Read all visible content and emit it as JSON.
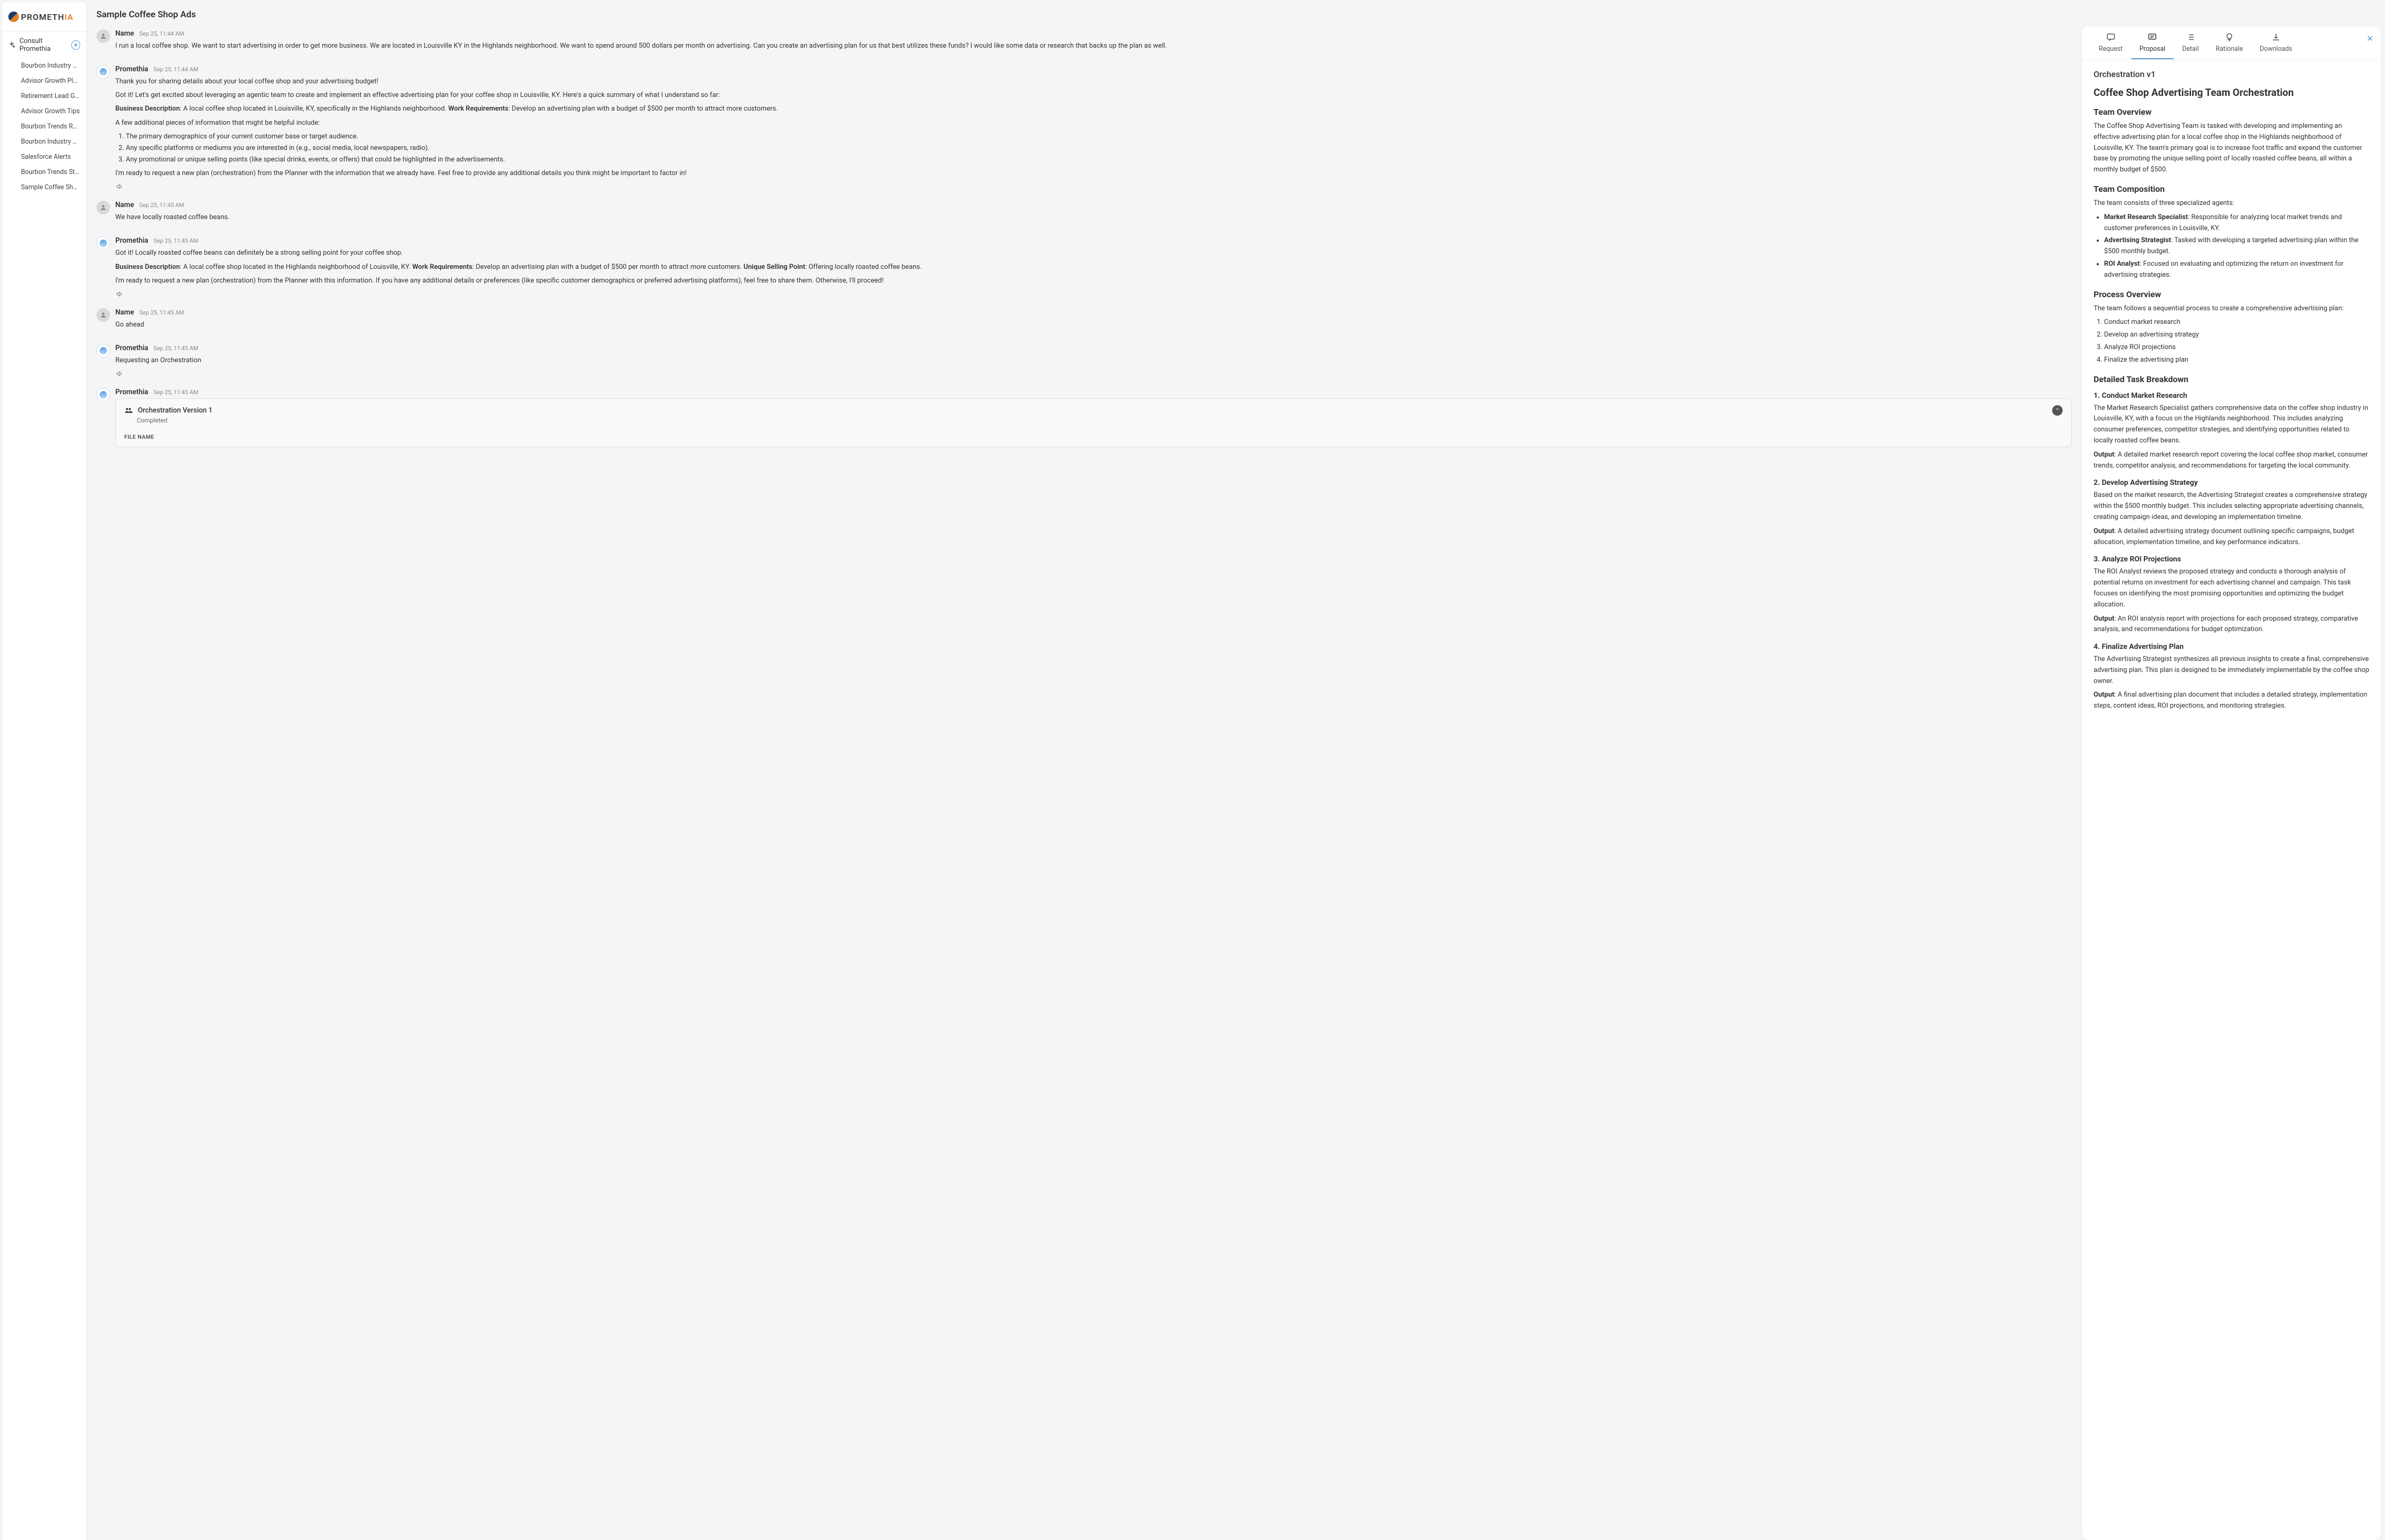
{
  "brand": {
    "name_a": "PROMETH",
    "name_b": "IA"
  },
  "sidebar": {
    "consult_label": "Consult Promethia",
    "items": [
      "Bourbon Industry St...",
      "Advisor Growth Plan",
      "Retirement Lead Gen",
      "Advisor Growth Tips",
      "Bourbon Trends Re...",
      "Bourbon Industry Tr...",
      "Salesforce Alerts",
      "Bourbon Trends Study",
      "Sample Coffee Sho..."
    ]
  },
  "page_title": "Sample Coffee Shop Ads",
  "messages": [
    {
      "author": "Name",
      "role": "user",
      "time": "Sep 25, 11:44 AM",
      "text1": "I run a local coffee shop. We want to start advertising in order to get more business. We are located in Louisville KY in the Highlands neighborhood. We want to spend around 500 dollars per month on advertising. Can you create an advertising plan for us that best utilizes these funds? I would like some data or research that backs up the plan as well."
    },
    {
      "author": "Promethia",
      "role": "bot",
      "time": "Sep 25, 11:44 AM",
      "text1": "Thank you for sharing details about your local coffee shop and your advertising budget!",
      "text2": "Got it! Let's get excited about leveraging an agentic team to create and implement an effective advertising plan for your coffee shop in Louisville, KY. Here's a quick summary of what I understand so far:",
      "biz_label": "Business Description",
      "biz_text": ": A local coffee shop located in Louisville, KY, specifically in the Highlands neighborhood. ",
      "work_label": "Work Requirements",
      "work_text": ": Develop an advertising plan with a budget of $500 per month to attract more customers.",
      "text3": "A few additional pieces of information that might be helpful include:",
      "li1": "The primary demographics of your current customer base or target audience.",
      "li2": "Any specific platforms or mediums you are interested in (e.g., social media, local newspapers, radio).",
      "li3": "Any promotional or unique selling points (like special drinks, events, or offers) that could be highlighted in the advertisements.",
      "text4": "I'm ready to request a new plan (orchestration) from the Planner with the information that we already have. Feel free to provide any additional details you think might be important to factor in!"
    },
    {
      "author": "Name",
      "role": "user",
      "time": "Sep 25, 11:45 AM",
      "text1": "We have locally roasted coffee beans."
    },
    {
      "author": "Promethia",
      "role": "bot",
      "time": "Sep 25, 11:45 AM",
      "text1": "Got it! Locally roasted coffee beans can definitely be a strong selling point for your coffee shop.",
      "biz_label": "Business Description",
      "biz_text": ": A local coffee shop located in the Highlands neighborhood of Louisville, KY. ",
      "work_label": "Work Requirements",
      "work_text": ": Develop an advertising plan with a budget of $500 per month to attract more customers. ",
      "usp_label": "Unique Selling Point",
      "usp_text": ": Offering locally roasted coffee beans.",
      "text2": "I'm ready to request a new plan (orchestration) from the Planner with this information. If you have any additional details or preferences (like specific customer demographics or preferred advertising platforms), feel free to share them. Otherwise, I'll proceed!"
    },
    {
      "author": "Name",
      "role": "user",
      "time": "Sep 25, 11:45 AM",
      "text1": "Go ahead"
    },
    {
      "author": "Promethia",
      "role": "bot",
      "time": "Sep 25, 11:45 AM",
      "text1": "Requesting an Orchestration"
    },
    {
      "author": "Promethia",
      "role": "bot",
      "time": "Sep 25, 11:45 AM",
      "orch_title": "Orchestration Version 1",
      "orch_status": "Completed",
      "file_label": "FILE NAME"
    }
  ],
  "detail": {
    "tabs": {
      "request": "Request",
      "proposal": "Proposal",
      "detail": "Detail",
      "rationale": "Rationale",
      "downloads": "Downloads"
    },
    "version": "Orchestration v1",
    "h1": "Coffee Shop Advertising Team Orchestration",
    "overview_h": "Team Overview",
    "overview_p": "The Coffee Shop Advertising Team is tasked with developing and implementing an effective advertising plan for a local coffee shop in the Highlands neighborhood of Louisville, KY. The team's primary goal is to increase foot traffic and expand the customer base by promoting the unique selling point of locally roasted coffee beans, all within a monthly budget of $500.",
    "comp_h": "Team Composition",
    "comp_p": "The team consists of three specialized agents:",
    "comp_li1_b": "Market Research Specialist",
    "comp_li1_t": ": Responsible for analyzing local market trends and customer preferences in Louisville, KY.",
    "comp_li2_b": "Advertising Strategist",
    "comp_li2_t": ": Tasked with developing a targeted advertising plan within the $500 monthly budget.",
    "comp_li3_b": "ROI Analyst",
    "comp_li3_t": ": Focused on evaluating and optimizing the return on investment for advertising strategies.",
    "proc_h": "Process Overview",
    "proc_p": "The team follows a sequential process to create a comprehensive advertising plan:",
    "proc_li1": "Conduct market research",
    "proc_li2": "Develop an advertising strategy",
    "proc_li3": "Analyze ROI projections",
    "proc_li4": "Finalize the advertising plan",
    "task_h": "Detailed Task Breakdown",
    "t1_h": "1. Conduct Market Research",
    "t1_p": "The Market Research Specialist gathers comprehensive data on the coffee shop industry in Louisville, KY, with a focus on the Highlands neighborhood. This includes analyzing consumer preferences, competitor strategies, and identifying opportunities related to locally roasted coffee beans.",
    "t1_ob": "Output",
    "t1_ot": ": A detailed market research report covering the local coffee shop market, consumer trends, competitor analysis, and recommendations for targeting the local community.",
    "t2_h": "2. Develop Advertising Strategy",
    "t2_p": "Based on the market research, the Advertising Strategist creates a comprehensive strategy within the $500 monthly budget. This includes selecting appropriate advertising channels, creating campaign ideas, and developing an implementation timeline.",
    "t2_ob": "Output",
    "t2_ot": ": A detailed advertising strategy document outlining specific campaigns, budget allocation, implementation timeline, and key performance indicators.",
    "t3_h": "3. Analyze ROI Projections",
    "t3_p": "The ROI Analyst reviews the proposed strategy and conducts a thorough analysis of potential returns on investment for each advertising channel and campaign. This task focuses on identifying the most promising opportunities and optimizing the budget allocation.",
    "t3_ob": "Output",
    "t3_ot": ": An ROI analysis report with projections for each proposed strategy, comparative analysis, and recommendations for budget optimization.",
    "t4_h": "4. Finalize Advertising Plan",
    "t4_p": "The Advertising Strategist synthesizes all previous insights to create a final, comprehensive advertising plan. This plan is designed to be immediately implementable by the coffee shop owner.",
    "t4_ob": "Output",
    "t4_ot": ": A final advertising plan document that includes a detailed strategy, implementation steps, content ideas, ROI projections, and monitoring strategies."
  }
}
